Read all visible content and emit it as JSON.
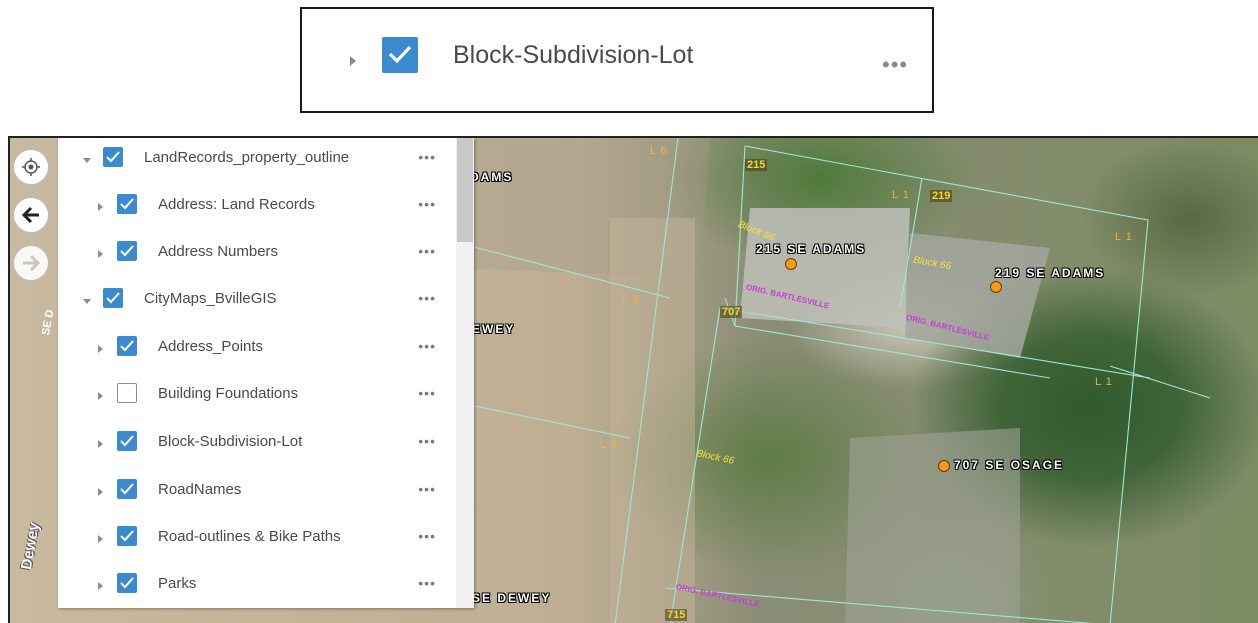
{
  "callout": {
    "label": "Block-Subdivision-Lot",
    "checked": true,
    "more": "•••"
  },
  "map": {
    "road_labels": [
      "DAMS",
      "EWEY",
      "SE DEWEY",
      "SE D",
      "Dewey"
    ],
    "building_labels": [
      "215 SE ADAMS",
      "219 SE ADAMS",
      "707 SE OSAGE"
    ],
    "parcel_numbers": [
      "215",
      "219",
      "707",
      "715"
    ],
    "lot_labels": [
      "L 6",
      "L 1",
      "L 1",
      "L 1",
      "L 6",
      "L 3"
    ],
    "block_labels": [
      "Block 66",
      "Block 66",
      "Block 66"
    ],
    "subdivision_labels": [
      "ORIG. BARTLESVILLE",
      "ORIG. BARTLESVILLE",
      "ORIG. BARTLESVILLE"
    ],
    "colors": {
      "parcel_line": "#9fe6d4",
      "point": "#f59b18",
      "lot_label": "#f2b13a",
      "block_label": "#f4e23a",
      "subdivision_label": "#c33fd6",
      "checkbox": "#3b8ad0"
    }
  },
  "tools": [
    {
      "name": "locate",
      "icon": "target-icon",
      "enabled": true
    },
    {
      "name": "back",
      "icon": "arrow-left-icon",
      "enabled": true
    },
    {
      "name": "forward",
      "icon": "arrow-right-icon",
      "enabled": false
    }
  ],
  "layers": [
    {
      "label": "LandRecords_property_outline",
      "checked": true,
      "expanded": true,
      "level": 0
    },
    {
      "label": "Address: Land Records",
      "checked": true,
      "expanded": false,
      "level": 1
    },
    {
      "label": "Address Numbers",
      "checked": true,
      "expanded": false,
      "level": 1
    },
    {
      "label": "CityMaps_BvilleGIS",
      "checked": true,
      "expanded": true,
      "level": 0
    },
    {
      "label": "Address_Points",
      "checked": true,
      "expanded": false,
      "level": 1
    },
    {
      "label": "Building Foundations",
      "checked": false,
      "expanded": false,
      "level": 1
    },
    {
      "label": "Block-Subdivision-Lot",
      "checked": true,
      "expanded": false,
      "level": 1
    },
    {
      "label": "RoadNames",
      "checked": true,
      "expanded": false,
      "level": 1
    },
    {
      "label": "Road-outlines & Bike Paths",
      "checked": true,
      "expanded": false,
      "level": 1
    },
    {
      "label": "Parks",
      "checked": true,
      "expanded": false,
      "level": 1
    }
  ],
  "more_label": "•••"
}
